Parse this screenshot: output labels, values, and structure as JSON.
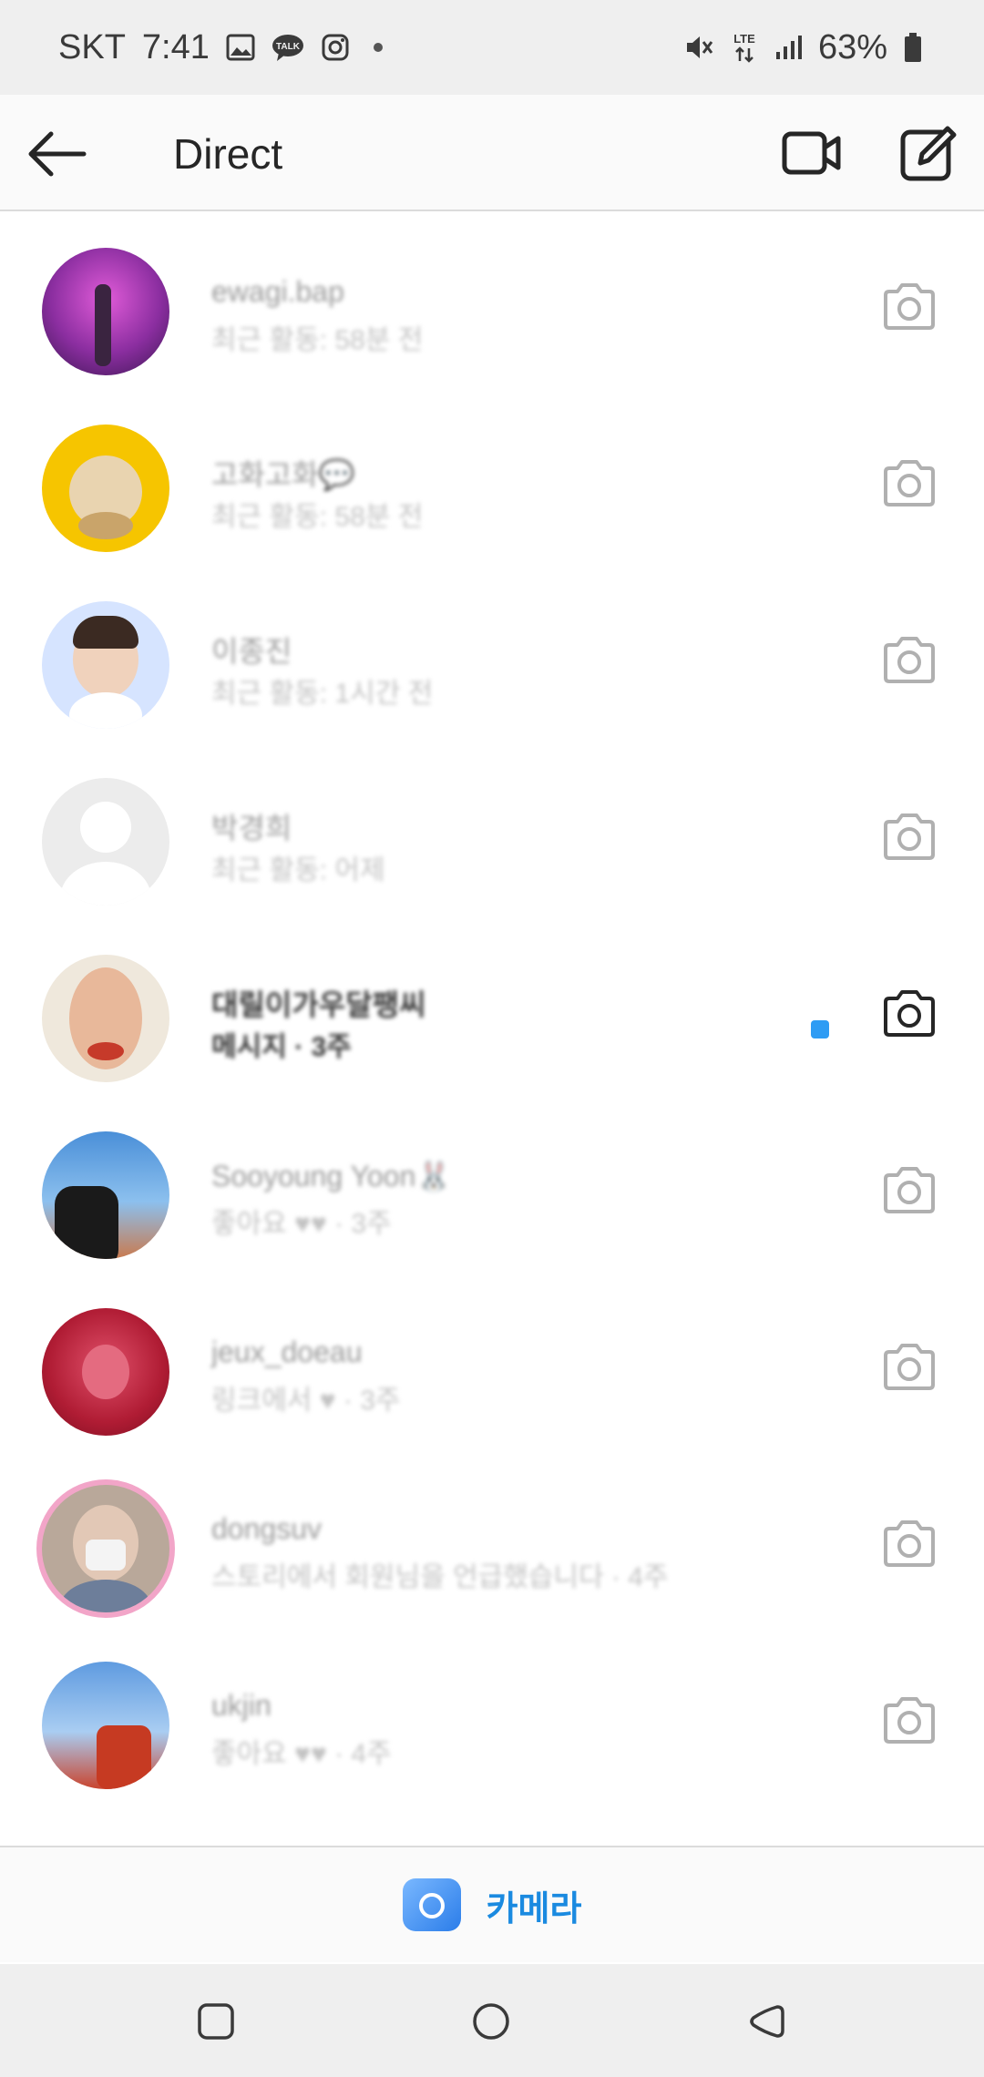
{
  "status_bar": {
    "carrier": "SKT",
    "time": "7:41",
    "network": "LTE",
    "battery": "63%",
    "icons": [
      "gallery-icon",
      "talk-icon",
      "instagram-icon",
      "dot-icon",
      "mute-icon",
      "lte-icon",
      "signal-icon",
      "battery-icon"
    ]
  },
  "header": {
    "title": "Direct",
    "back_icon": "arrow-left-icon",
    "video_icon": "video-camera-icon",
    "compose_icon": "compose-icon"
  },
  "threads": [
    {
      "name": "ewagi.bap",
      "subtitle": "최근 활동: 58분 전",
      "unread": false
    },
    {
      "name": "고화고화💬",
      "subtitle": "최근 활동: 58분 전",
      "unread": false
    },
    {
      "name": "이종진",
      "subtitle": "최근 활동: 1시간 전",
      "unread": false
    },
    {
      "name": "박경희",
      "subtitle": "최근 활동: 어제",
      "unread": false
    },
    {
      "name": "대릴이가우달팽씨",
      "subtitle": "메시지 · 3주",
      "unread": true
    },
    {
      "name": "Sooyoung Yoon🐰",
      "subtitle": "좋아요 ♥♥ · 3주",
      "unread": false
    },
    {
      "name": "jeux_doeau",
      "subtitle": "링크에서 ♥ · 3주",
      "unread": false
    },
    {
      "name": "dongsuv",
      "subtitle": "스토리에서 회원님을 언급했습니다 · 4주",
      "unread": false
    },
    {
      "name": "ukjin",
      "subtitle": "좋아요 ♥♥ · 4주",
      "unread": false
    }
  ],
  "camera_bar": {
    "label": "카메라"
  },
  "colors": {
    "accent": "#1a8ae0",
    "unread_dot": "#2e9cf4",
    "status_bar_bg": "#efefef"
  },
  "nav": {
    "recents_icon": "recents-square-icon",
    "home_icon": "home-circle-icon",
    "back_icon": "back-triangle-icon"
  }
}
